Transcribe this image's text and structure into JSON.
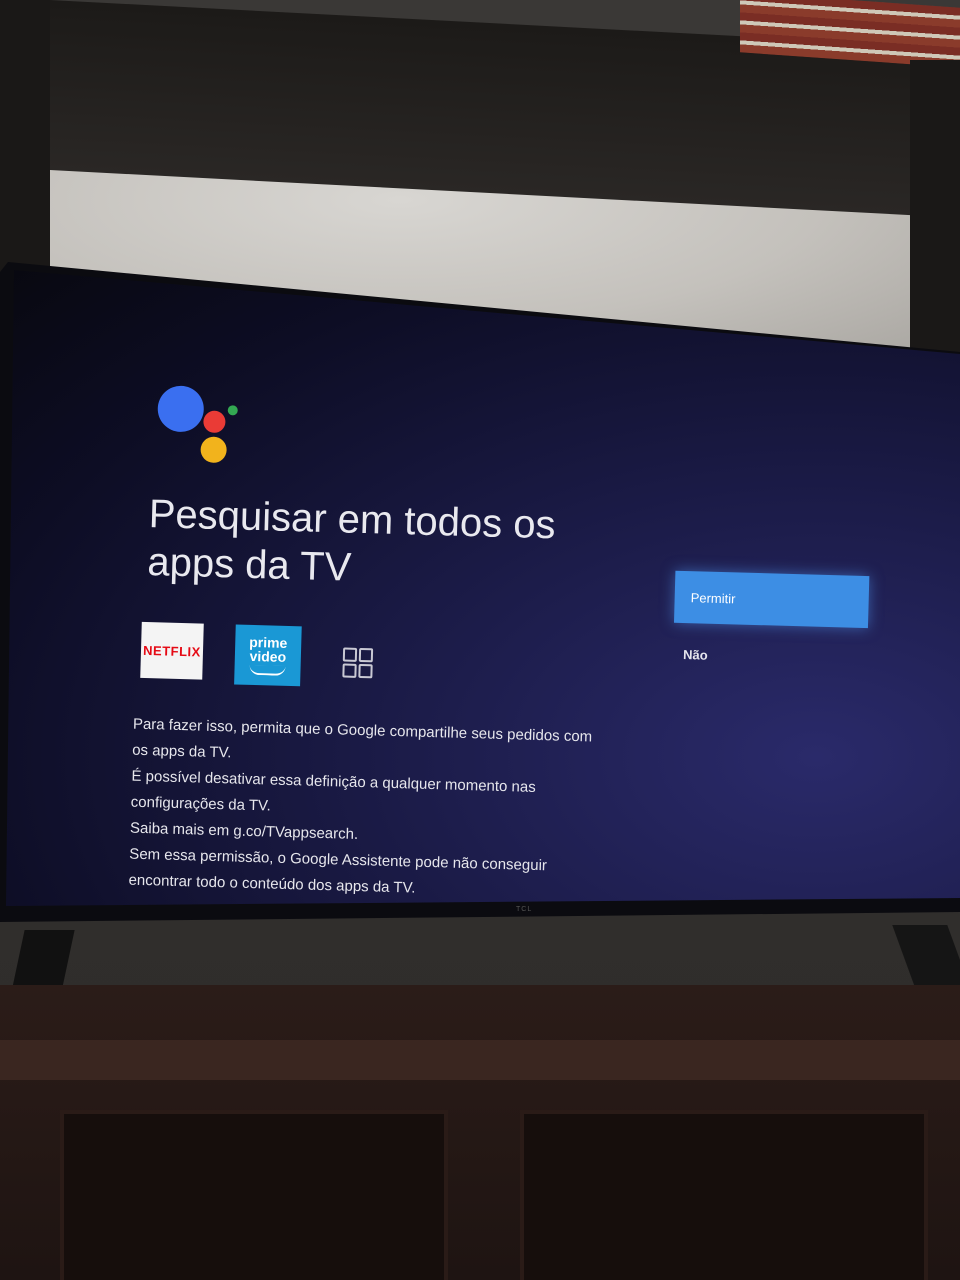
{
  "screen": {
    "title_line1": "Pesquisar em todos os",
    "title_line2": "apps da TV",
    "apps": [
      {
        "label": "NETFLIX",
        "icon": "netflix-icon"
      },
      {
        "label_line1": "prime",
        "label_line2": "video",
        "icon": "prime-video-icon"
      },
      {
        "icon": "apps-grid-icon"
      }
    ],
    "paragraphs": [
      "Para fazer isso, permita que o Google compartilhe seus pedidos com",
      "os apps da TV.",
      "É possível desativar essa definição a qualquer momento nas",
      "configurações da TV.",
      "Saiba mais em g.co/TVappsearch.",
      "Sem essa permissão, o Google Assistente pode não conseguir",
      "encontrar todo o conteúdo dos apps da TV."
    ],
    "allow_label": "Permitir",
    "deny_label": "Não"
  },
  "tv": {
    "brand": "TCL"
  },
  "colors": {
    "accent": "#3d8ee4",
    "assistant_blue": "#3a6ff0",
    "assistant_red": "#ea3b36",
    "assistant_yellow": "#f2b31c",
    "assistant_green": "#33a852",
    "netflix_red": "#e50914",
    "prime_blue": "#1a98d5"
  }
}
